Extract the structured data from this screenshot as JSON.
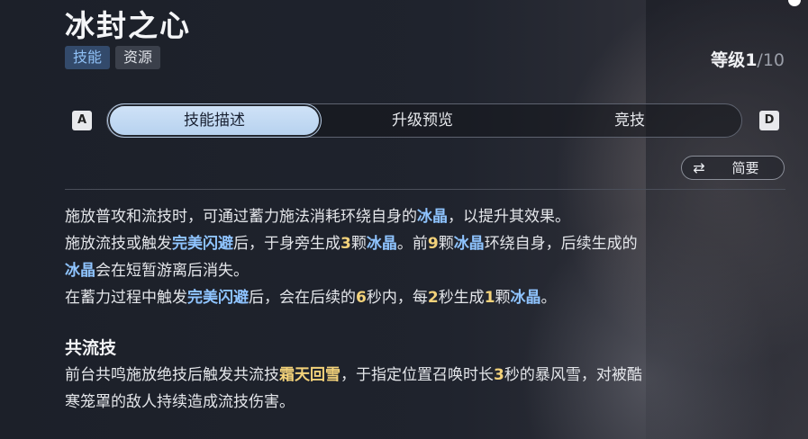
{
  "header": {
    "title": "冰封之心",
    "tags": [
      "技能",
      "资源"
    ],
    "level_label": "等级",
    "level_current": "1",
    "level_max": "/10"
  },
  "tabs": {
    "left_key": "A",
    "right_key": "D",
    "items": [
      "技能描述",
      "升级预览",
      "竞技"
    ],
    "active_index": 0
  },
  "summary_button": {
    "icon": "swap-arrows-icon",
    "label": "简要"
  },
  "description": {
    "line1": [
      "施放普攻和流技时，可通过蓄力施法消耗环绕自身的",
      "冰晶",
      "，以提升其效果。"
    ],
    "line2": [
      "施放流技或触发",
      "完美闪避",
      "后，于身旁生成",
      "3",
      "颗",
      "冰晶",
      "。前",
      "9",
      "颗",
      "冰晶",
      "环绕自身，后续生成的"
    ],
    "line3": [
      "冰晶",
      "会在短暂游离后消失。"
    ],
    "line4": [
      "在蓄力过程中触发",
      "完美闪避",
      "后，会在后续的",
      "6",
      "秒内，每",
      "2",
      "秒生成",
      "1",
      "颗",
      "冰晶",
      "。"
    ]
  },
  "section": {
    "title": "共流技",
    "line1": [
      "前台共鸣施放绝技后触发共流技",
      "霜天回雪",
      "，于指定位置召唤时长",
      "3",
      "秒的暴风雪，对被酷"
    ],
    "line2": [
      "寒笼罩的敌人持续造成流技伤害。"
    ]
  },
  "colors": {
    "keyword_blue": "#8fc4ff",
    "number_gold": "#f3d27a",
    "active_tab": "#cfe2f7",
    "active_tag": "#334a6b"
  }
}
